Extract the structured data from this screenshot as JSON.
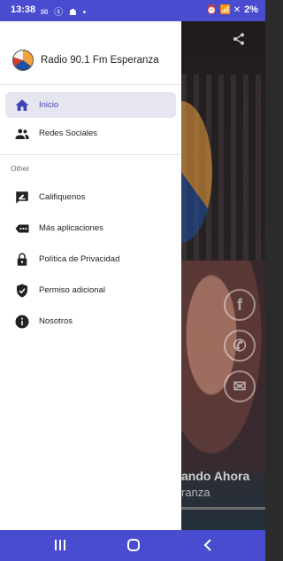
{
  "status_bar": {
    "time": "13:38",
    "notification_glyphs": "✉ ⓢ ☗ •",
    "right_glyphs": "⏰ 📶 ✕",
    "battery": "2%"
  },
  "background_app": {
    "now_playing_title": "ando Ahora",
    "now_playing_subtitle": "ranza",
    "social_icons": [
      "facebook-icon",
      "whatsapp-icon",
      "email-icon"
    ]
  },
  "drawer": {
    "app_title": "Radio 90.1 Fm Esperanza",
    "primary_items": [
      {
        "label": "Inicio",
        "icon": "home-icon",
        "active": true
      },
      {
        "label": "Redes Sociales",
        "icon": "people-icon",
        "active": false
      }
    ],
    "section_label": "Other",
    "other_items": [
      {
        "label": "Califiquenos",
        "icon": "rate-review-icon"
      },
      {
        "label": "Más aplicaciones",
        "icon": "more-apps-icon"
      },
      {
        "label": "Política de Privacidad",
        "icon": "lock-icon"
      },
      {
        "label": "Permiso adicional",
        "icon": "verified-shield-icon"
      },
      {
        "label": "Nosotros",
        "icon": "info-icon"
      }
    ]
  },
  "colors": {
    "accent": "#4a4ccf",
    "active_item_bg": "#e6e6f1",
    "active_item_text": "#3f42b8",
    "drawer_bg": "#ffffff"
  }
}
